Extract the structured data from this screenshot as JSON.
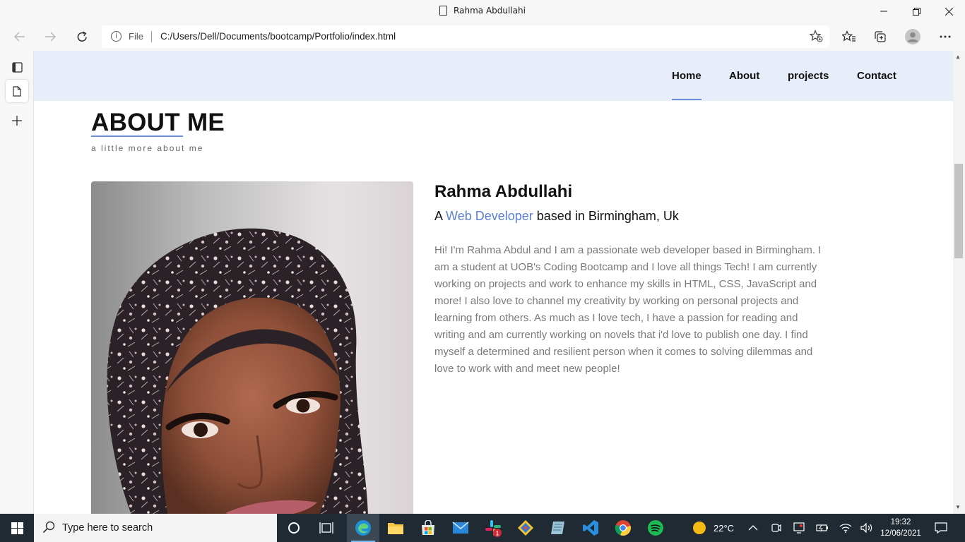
{
  "window": {
    "title": "Rahma Abdullahi",
    "minimize_icon": "minimize-icon",
    "maximize_icon": "restore-icon",
    "close_icon": "close-icon"
  },
  "toolbar": {
    "address_scheme": "File",
    "address_url": "C:/Users/Dell/Documents/bootcamp/Portfolio/index.html"
  },
  "site": {
    "nav": [
      {
        "label": "Home",
        "active": true
      },
      {
        "label": "About",
        "active": false
      },
      {
        "label": "projects",
        "active": false
      },
      {
        "label": "Contact",
        "active": false
      }
    ],
    "about_title": "ABOUT ME",
    "about_subtitle": "a little more about me",
    "name": "Rahma Abdullahi",
    "role_prefix": "A",
    "role_highlight": "Web Developer",
    "role_suffix": "based in Birmingham, Uk",
    "bio": "Hi! I'm Rahma Abdul and I am a passionate web developer based in Birmingham. I am a student at UOB's Coding Bootcamp and I love all things Tech! I am currently working on projects and work to enhance my skills in HTML, CSS, JavaScript and more! I also love to channel my creativity by working on personal projects and learning from others. As much as I love tech, I have a passion for reading and writing and am currently working on novels that i'd love to publish one day. I find myself a determined and resilient person when it comes to solving dilemmas and love to work with and meet new people!",
    "accent_color": "#6b8ed6",
    "nav_bg_color": "#e8eef9"
  },
  "taskbar": {
    "search_placeholder": "Type here to search",
    "weather": "22°C",
    "time": "19:32",
    "date": "12/06/2021",
    "slack_badge": "1"
  }
}
